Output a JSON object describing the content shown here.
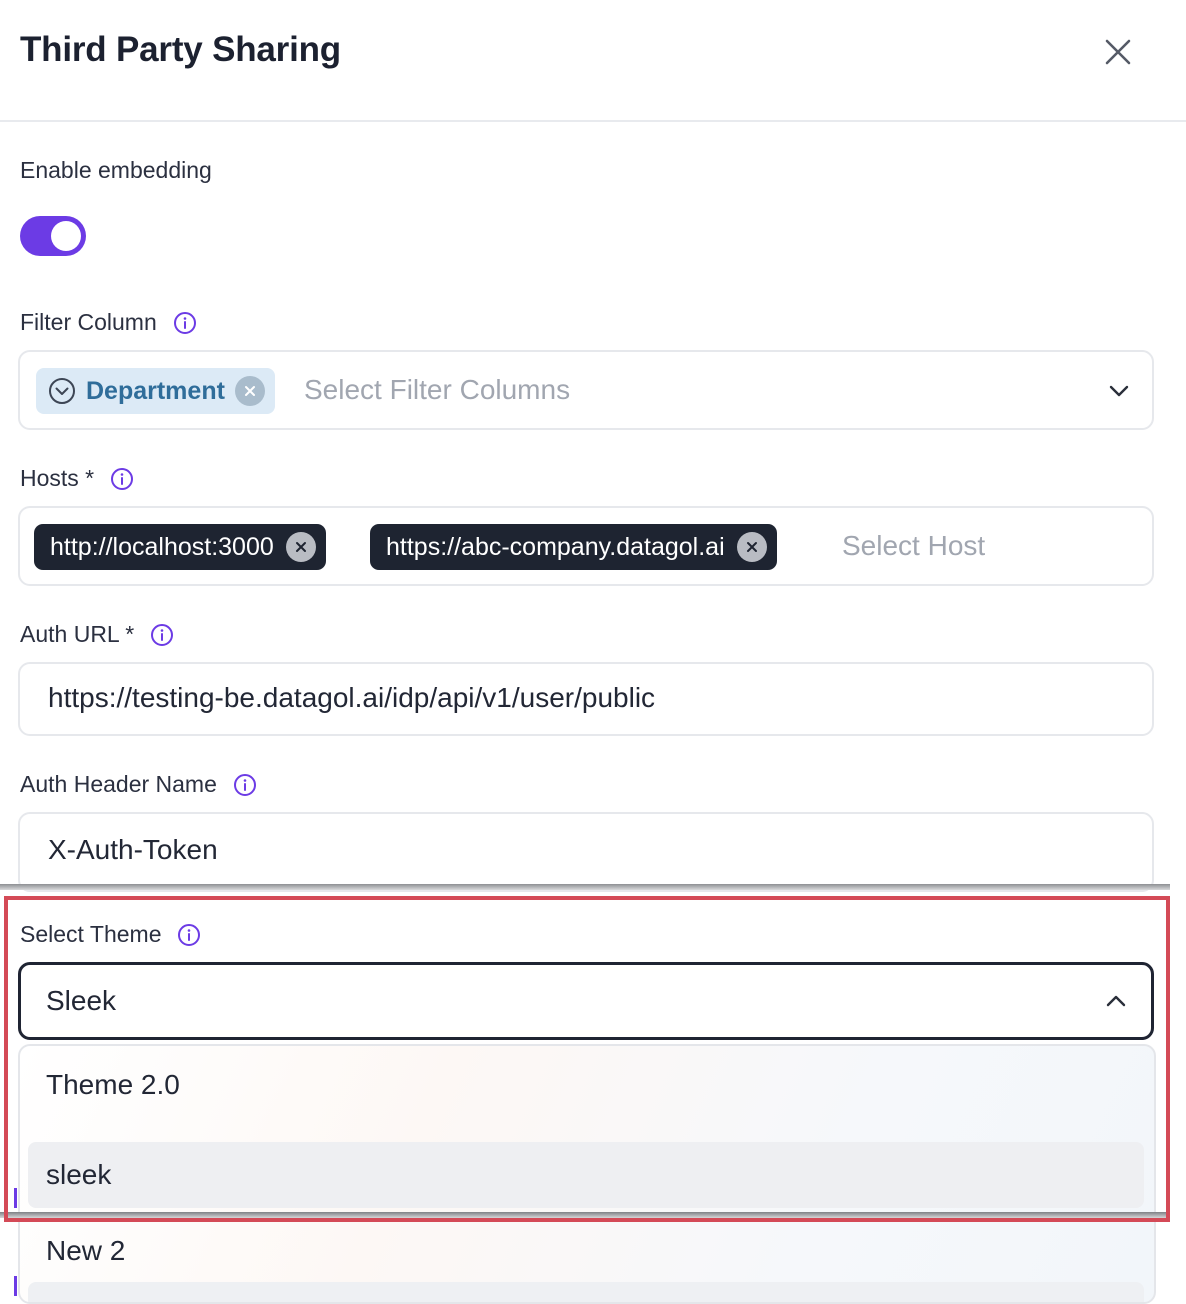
{
  "header": {
    "title": "Third Party Sharing"
  },
  "embedding": {
    "label": "Enable embedding",
    "enabled": true
  },
  "filter_column": {
    "label": "Filter Column",
    "chip": "Department",
    "placeholder": "Select Filter Columns"
  },
  "hosts": {
    "label": "Hosts *",
    "chips": [
      "http://localhost:3000",
      "https://abc-company.datagol.ai"
    ],
    "placeholder": "Select Host"
  },
  "auth_url": {
    "label": "Auth URL *",
    "value": "https://testing-be.datagol.ai/idp/api/v1/user/public"
  },
  "auth_header": {
    "label": "Auth Header Name",
    "value": "X-Auth-Token"
  },
  "theme": {
    "label": "Select Theme",
    "value": "Sleek",
    "options": [
      "Theme 2.0",
      "sleek",
      "New 2"
    ]
  },
  "colors": {
    "accent": "#6c3be5",
    "highlight_border": "#d44a57",
    "dark_chip": "#1e2431",
    "light_chip": "#dceaf6"
  }
}
